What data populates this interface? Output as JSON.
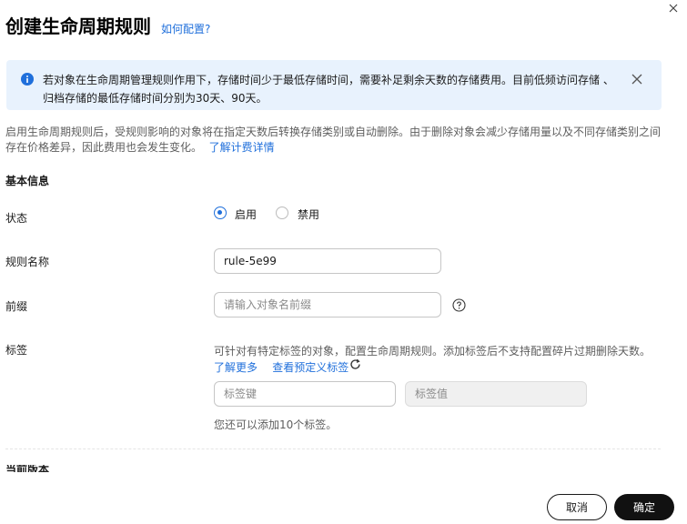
{
  "dialog": {
    "title": "创建生命周期规则",
    "help_link": "如何配置?"
  },
  "notice": {
    "line1": "若对象在生命周期管理规则作用下，存储时间少于最低存储时间，需要补足剩余天数的存储费用。目前低频访问存储 、",
    "line2": "归档存储的最低存储时间分别为30天、90天。"
  },
  "description": {
    "line1": "启用生命周期规则后，受规则影响的对象将在指定天数后转换存储类别或自动删除。由于删除对象会减少存储用量以及不同存储类别之间",
    "line2": "存在价格差异，因此费用也会发生变化。",
    "link": "了解计费详情"
  },
  "basic_info": {
    "heading": "基本信息",
    "status_label": "状态",
    "status_options": [
      "启用",
      "禁用"
    ],
    "status_selected": "启用",
    "name_label": "规则名称",
    "name_value": "rule-5e99",
    "prefix_label": "前缀",
    "prefix_placeholder": "请输入对象名前缀",
    "tag_label": "标签",
    "tag_hint": "可针对有特定标签的对象，配置生命周期规则。添加标签后不支持配置碎片过期删除天数。",
    "tag_learn_more": "了解更多",
    "tag_view_predefined": "查看预定义标签",
    "tag_key_placeholder": "标签键",
    "tag_value_placeholder": "标签值",
    "tag_count_hint": "您还可以添加10个标签。"
  },
  "next_section_partial": "当前版本",
  "footer": {
    "cancel_label": "取消",
    "ok_label": "确定"
  },
  "colors": {
    "accent": "#1f6fdb",
    "notice_bg": "#e8f2fd",
    "primary_button": "#111111"
  }
}
